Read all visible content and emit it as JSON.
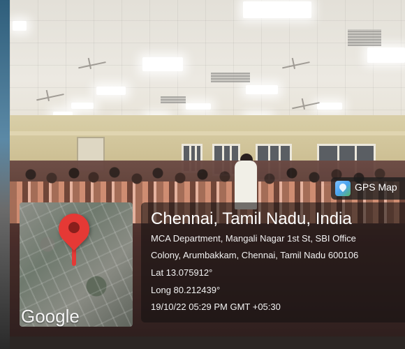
{
  "gps_badge": {
    "label": "GPS Map",
    "icon": "gps-map-camera-icon"
  },
  "location": {
    "title": "Chennai, Tamil Nadu, India",
    "address_line1": "MCA Department, Mangali Nagar 1st St, SBI Office",
    "address_line2": "Colony, Arumbakkam, Chennai, Tamil Nadu 600106",
    "lat_label": "Lat 13.075912°",
    "long_label": "Long 80.212439°",
    "timestamp": "19/10/22 05:29 PM GMT +05:30"
  },
  "map": {
    "brand": "Google",
    "pin_icon": "map-pin-icon",
    "pin_color": "#e53935"
  }
}
